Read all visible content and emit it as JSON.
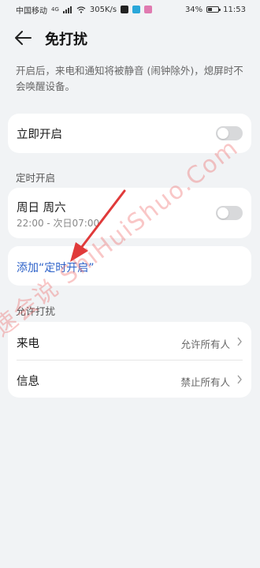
{
  "status_bar": {
    "carrier": "中国移动",
    "network": "4G",
    "speed": "305K/s",
    "battery": "34%",
    "time": "11:53"
  },
  "header": {
    "title": "免打扰"
  },
  "description": "开启后，来电和通知将被静音 (闹钟除外)，熄屏时不会唤醒设备。",
  "immediate": {
    "label": "立即开启",
    "enabled": false
  },
  "scheduled": {
    "section_label": "定时开启",
    "days": "周日 周六",
    "time_range": "22:00 - 次日07:00",
    "enabled": false,
    "add_link": "添加“定时开启”"
  },
  "allow": {
    "section_label": "允许打扰",
    "calls_label": "来电",
    "calls_value": "允许所有人",
    "messages_label": "信息",
    "messages_value": "禁止所有人"
  },
  "watermark": "速会说 ShiHuiShuo.Com",
  "colors": {
    "background": "#f1f3f5",
    "link": "#2d62c9",
    "toggle_off": "#d8d9db",
    "annotation_arrow": "#e03a3a"
  }
}
